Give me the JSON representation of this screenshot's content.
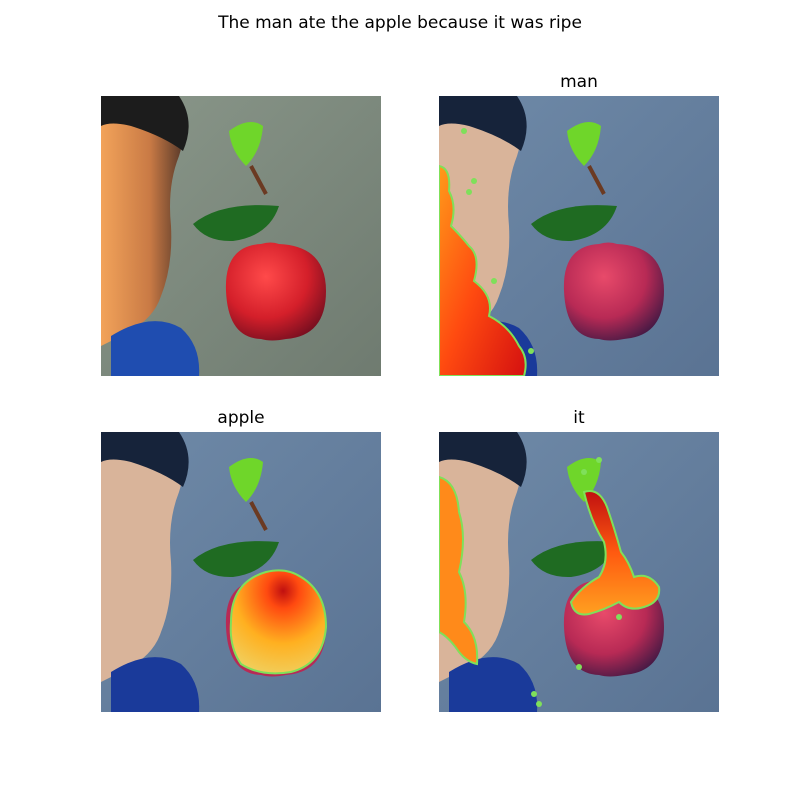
{
  "figure": {
    "title": "The man ate the apple because it was ripe"
  },
  "panels": [
    {
      "title": ""
    },
    {
      "title": "man"
    },
    {
      "title": "apple"
    },
    {
      "title": "it"
    }
  ]
}
